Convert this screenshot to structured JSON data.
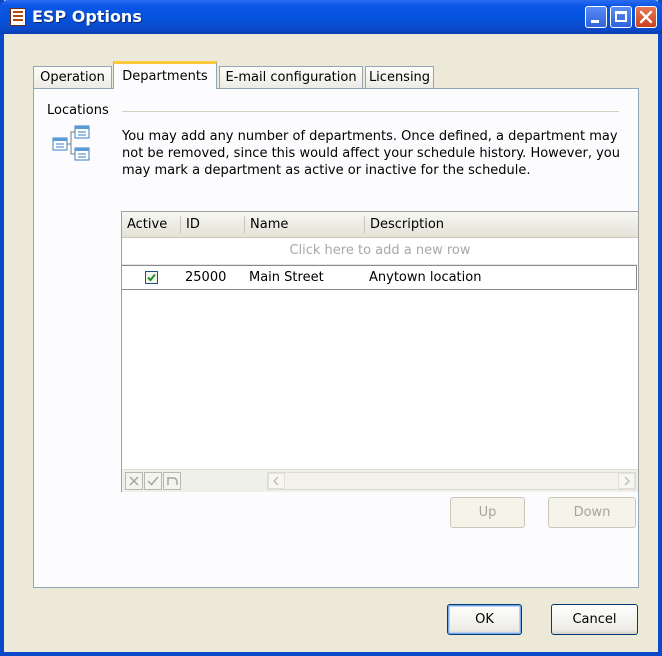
{
  "window": {
    "title": "ESP Options"
  },
  "tabs": [
    {
      "label": "Operation",
      "active": false
    },
    {
      "label": "Departments",
      "active": true
    },
    {
      "label": "E-mail configuration",
      "active": false
    },
    {
      "label": "Licensing",
      "active": false
    }
  ],
  "group": {
    "label": "Locations",
    "description": "You may add any number of departments. Once defined, a department may not be removed, since this would affect your schedule history. However, you may mark a department as active or inactive for the schedule."
  },
  "grid": {
    "columns": [
      "Active",
      "ID",
      "Name",
      "Description"
    ],
    "new_row_hint": "Click here to add a new row",
    "rows": [
      {
        "active": true,
        "id": "25000",
        "name": "Main Street",
        "description": "Anytown location"
      }
    ]
  },
  "buttons": {
    "up": "Up",
    "down": "Down",
    "ok": "OK",
    "cancel": "Cancel"
  },
  "colors": {
    "titlebar": "#0453de",
    "tab_highlight": "#ffc83c",
    "check": "#1f8f1f"
  }
}
